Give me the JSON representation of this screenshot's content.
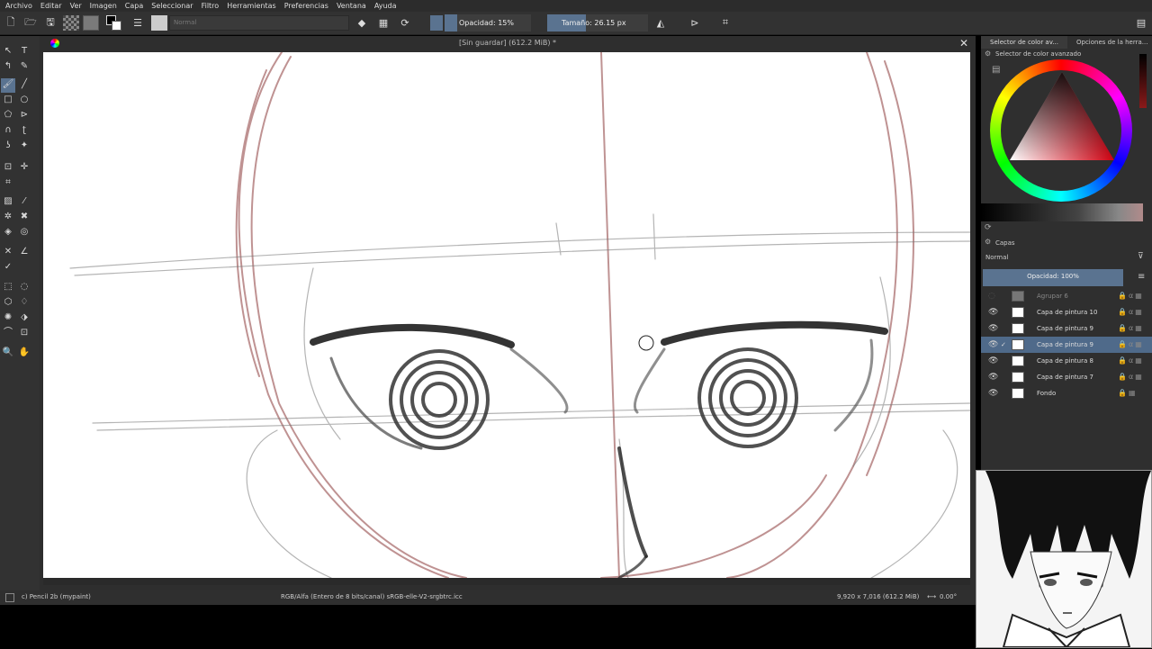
{
  "menu": [
    "Archivo",
    "Editar",
    "Ver",
    "Imagen",
    "Capa",
    "Seleccionar",
    "Filtro",
    "Herramientas",
    "Preferencias",
    "Ventana",
    "Ayuda"
  ],
  "toolbar": {
    "blend_mode": "Normal",
    "opacity_label": "Opacidad: 15%",
    "opacity_value": 0.15,
    "size_label": "Tamaño: 26.15 px"
  },
  "document": {
    "title": "[Sin guardar]  (612.2 MiB) *"
  },
  "statusbar": {
    "brush": "c) Pencil 2b (mypaint)",
    "color_space": "RGB/Alfa (Entero de 8 bits/canal)  sRGB-elle-V2-srgbtrc.icc",
    "dimensions": "9,920 x 7,016 (612.2 MiB)",
    "rotation": "0.00°"
  },
  "dockers": {
    "tab_color": "Selector de color av...",
    "tab_tool_options": "Opciones de la herra...",
    "color_header": "Selector de color avanzado",
    "layers_header": "Capas",
    "layer_blend": "Normal",
    "layer_opacity_label": "Opacidad:  100%",
    "layer_opacity_value": 1.0
  },
  "layers": [
    {
      "name": "Agrupar 6",
      "visible": false,
      "selected": false
    },
    {
      "name": "Capa de pintura 10",
      "visible": true,
      "selected": false
    },
    {
      "name": "Capa de pintura 9",
      "visible": true,
      "selected": false
    },
    {
      "name": "Capa de pintura 9",
      "visible": true,
      "selected": true
    },
    {
      "name": "Capa de pintura 8",
      "visible": true,
      "selected": false
    },
    {
      "name": "Capa de pintura 7",
      "visible": true,
      "selected": false
    },
    {
      "name": "Fondo",
      "visible": true,
      "selected": false
    }
  ],
  "colors": {
    "accent": "#5a7390",
    "selected_row": "#4f6a8a",
    "sketch_red": "#8b3a3a"
  },
  "icons": [
    "new-document-icon",
    "open-icon",
    "save-icon",
    "eraser-icon",
    "mirror-icon",
    "crop-icon",
    "brush-icon",
    "move-icon",
    "zoom-icon",
    "pan-icon"
  ]
}
